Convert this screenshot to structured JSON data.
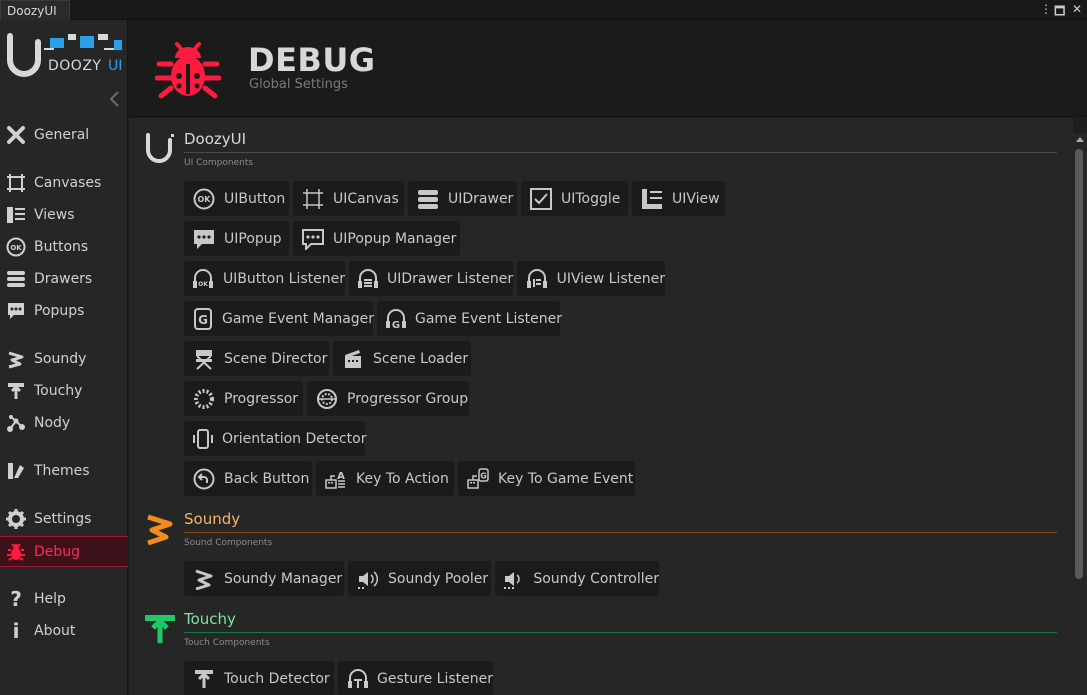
{
  "window": {
    "tab_title": "DoozyUI",
    "controls": [
      "⋮",
      "🗖",
      "✕"
    ]
  },
  "logo": {
    "text_main": "DOOZY",
    "text_accent": "UI"
  },
  "sidebar": {
    "items": [
      {
        "label": "General",
        "icon": "general-icon"
      },
      {
        "label": "Canvases",
        "icon": "canvas-icon"
      },
      {
        "label": "Views",
        "icon": "view-icon"
      },
      {
        "label": "Buttons",
        "icon": "ok-button-icon"
      },
      {
        "label": "Drawers",
        "icon": "drawer-icon"
      },
      {
        "label": "Popups",
        "icon": "popup-icon"
      },
      {
        "label": "Soundy",
        "icon": "soundy-icon"
      },
      {
        "label": "Touchy",
        "icon": "touchy-icon"
      },
      {
        "label": "Nody",
        "icon": "nody-icon"
      },
      {
        "label": "Themes",
        "icon": "themes-icon"
      },
      {
        "label": "Settings",
        "icon": "gear-icon"
      },
      {
        "label": "Debug",
        "icon": "bug-icon",
        "active": true
      },
      {
        "label": "Help",
        "icon": "question-icon"
      },
      {
        "label": "About",
        "icon": "info-icon"
      }
    ]
  },
  "header": {
    "title": "DEBUG",
    "subtitle": "Global Settings"
  },
  "colors": {
    "accent_debug": "#ff1a40",
    "soundy": "#f28c1b",
    "touchy": "#1ec96a",
    "doozy": "#d8d8d8"
  },
  "sections": {
    "doozy": {
      "title": "DoozyUI",
      "subtitle": "UI Components",
      "buttons": [
        "UIButton",
        "UICanvas",
        "UIDrawer",
        "UIToggle",
        "UIView",
        "UIPopup",
        "UIPopup Manager",
        "UIButton Listener",
        "UIDrawer Listener",
        "UIView Listener",
        "Game Event Manager",
        "Game Event Listener",
        "Scene Director",
        "Scene Loader",
        "Progressor",
        "Progressor Group",
        "Orientation Detector",
        "Back Button",
        "Key To Action",
        "Key To Game Event"
      ]
    },
    "soundy": {
      "title": "Soundy",
      "subtitle": "Sound Components",
      "buttons": [
        "Soundy Manager",
        "Soundy Pooler",
        "Soundy Controller"
      ]
    },
    "touchy": {
      "title": "Touchy",
      "subtitle": "Touch Components",
      "buttons": [
        "Touch Detector",
        "Gesture Listener"
      ]
    }
  }
}
